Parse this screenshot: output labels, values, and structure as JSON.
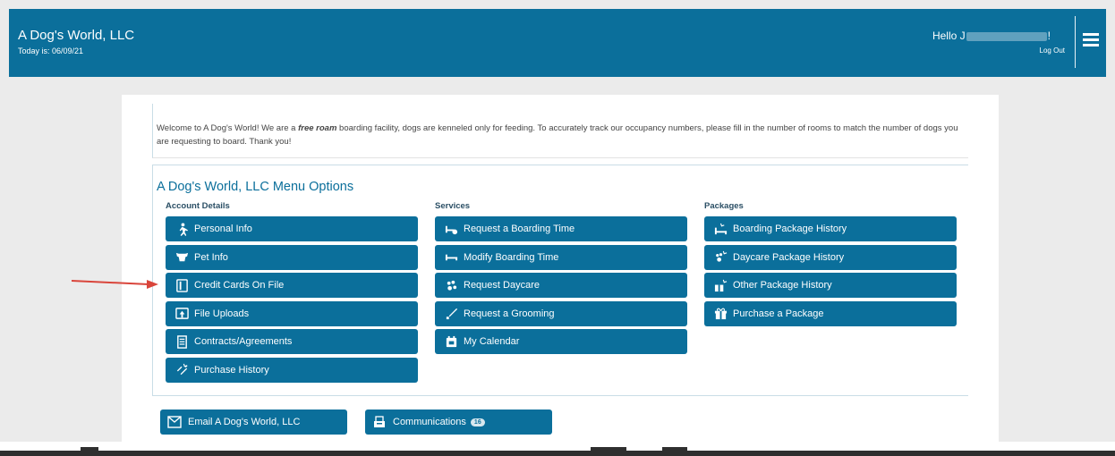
{
  "header": {
    "brand": "A Dog's World, LLC",
    "today": "Today is: 06/09/21",
    "hello_prefix": "Hello J",
    "hello_suffix": "!",
    "logout": "Log Out"
  },
  "welcome": {
    "before": "Welcome to A Dog's World! We are a ",
    "emphasis": "free roam",
    "after": " boarding facility, dogs are kenneled only for feeding. To accurately track our occupancy numbers, please fill in the number of rooms to match the number of dogs you are requesting to board.  Thank you!"
  },
  "menu": {
    "title": "A Dog's World, LLC Menu Options",
    "account": {
      "heading": "Account Details",
      "items": [
        {
          "label": "Personal Info",
          "icon": "person-walking-icon"
        },
        {
          "label": "Pet Info",
          "icon": "dog-icon"
        },
        {
          "label": "Credit Cards On File",
          "icon": "credit-card-icon"
        },
        {
          "label": "File Uploads",
          "icon": "upload-icon"
        },
        {
          "label": "Contracts/Agreements",
          "icon": "document-icon"
        },
        {
          "label": "Purchase History",
          "icon": "history-icon"
        }
      ]
    },
    "services": {
      "heading": "Services",
      "items": [
        {
          "label": "Request a Boarding Time",
          "icon": "bed-plus-icon"
        },
        {
          "label": "Modify Boarding Time",
          "icon": "bed-icon"
        },
        {
          "label": "Request Daycare",
          "icon": "paws-icon"
        },
        {
          "label": "Request a Grooming",
          "icon": "brush-icon"
        },
        {
          "label": "My Calendar",
          "icon": "calendar-icon"
        }
      ]
    },
    "packages": {
      "heading": "Packages",
      "items": [
        {
          "label": "Boarding Package History",
          "icon": "bed-history-icon"
        },
        {
          "label": "Daycare Package History",
          "icon": "paw-history-icon"
        },
        {
          "label": "Other Package History",
          "icon": "package-history-icon"
        },
        {
          "label": "Purchase a Package",
          "icon": "gift-icon"
        }
      ]
    }
  },
  "footer_actions": {
    "email": "Email A Dog's World, LLC",
    "communications": "Communications",
    "communications_count": "16"
  },
  "colors": {
    "brand": "#0b6f9b",
    "page_bg": "#ebebeb",
    "arrow": "#d9453b"
  }
}
